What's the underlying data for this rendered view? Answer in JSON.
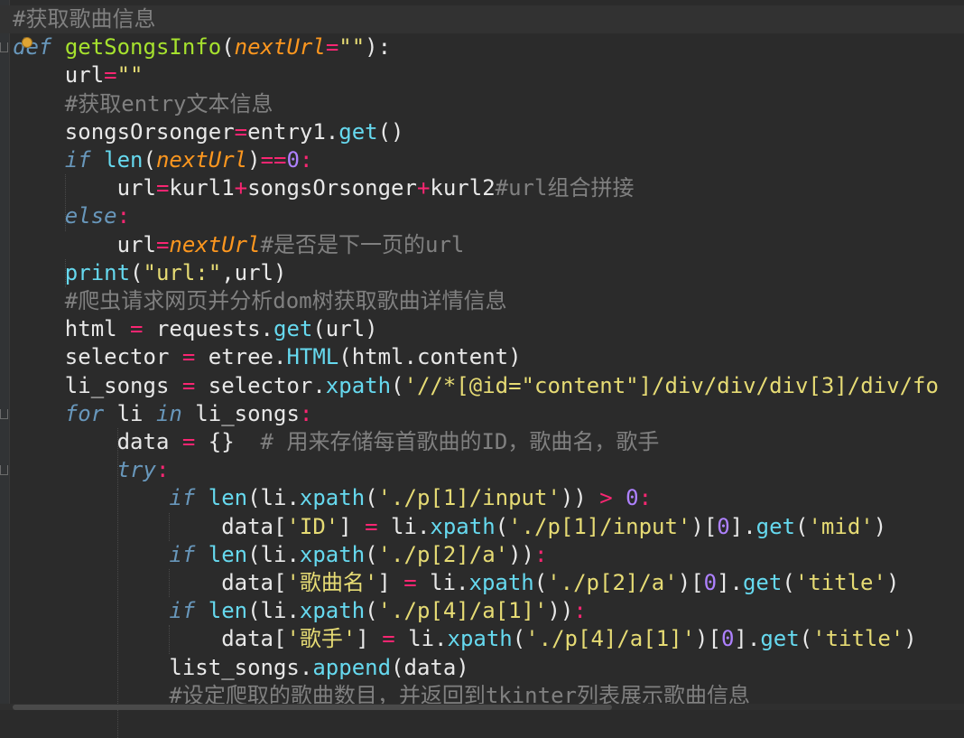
{
  "editor": {
    "lines": [
      {
        "tokens": [
          {
            "t": "#获取歌曲信息",
            "c": "cm"
          }
        ]
      },
      {
        "tokens": [
          {
            "t": "def",
            "c": "kw"
          },
          {
            "t": " ",
            "c": "pl"
          },
          {
            "t": "getSongsInfo",
            "c": "fn"
          },
          {
            "t": "(",
            "c": "pl"
          },
          {
            "t": "nextUrl",
            "c": "prm"
          },
          {
            "t": "=",
            "c": "op"
          },
          {
            "t": "\"\"",
            "c": "st"
          },
          {
            "t": "):",
            "c": "pl"
          }
        ]
      },
      {
        "tokens": [
          {
            "t": "    url",
            "c": "pl"
          },
          {
            "t": "=",
            "c": "op"
          },
          {
            "t": "\"\"",
            "c": "st"
          }
        ]
      },
      {
        "tokens": [
          {
            "t": "    #获取entry文本信息",
            "c": "cm"
          }
        ]
      },
      {
        "tokens": [
          {
            "t": "    songsOrsonger",
            "c": "pl"
          },
          {
            "t": "=",
            "c": "op"
          },
          {
            "t": "entry1.",
            "c": "pl"
          },
          {
            "t": "get",
            "c": "bi"
          },
          {
            "t": "()",
            "c": "pl"
          }
        ]
      },
      {
        "tokens": [
          {
            "t": "    ",
            "c": "pl"
          },
          {
            "t": "if",
            "c": "kw"
          },
          {
            "t": " ",
            "c": "pl"
          },
          {
            "t": "len",
            "c": "bi"
          },
          {
            "t": "(",
            "c": "pl"
          },
          {
            "t": "nextUrl",
            "c": "prm"
          },
          {
            "t": ")",
            "c": "pl"
          },
          {
            "t": "==",
            "c": "op"
          },
          {
            "t": "0",
            "c": "nm"
          },
          {
            "t": ":",
            "c": "op"
          }
        ]
      },
      {
        "tokens": [
          {
            "t": "        url",
            "c": "pl"
          },
          {
            "t": "=",
            "c": "op"
          },
          {
            "t": "kurl1",
            "c": "pl"
          },
          {
            "t": "+",
            "c": "op"
          },
          {
            "t": "songsOrsonger",
            "c": "pl"
          },
          {
            "t": "+",
            "c": "op"
          },
          {
            "t": "kurl2",
            "c": "pl"
          },
          {
            "t": "#url组合拼接",
            "c": "cm"
          }
        ]
      },
      {
        "tokens": [
          {
            "t": "    ",
            "c": "pl"
          },
          {
            "t": "else",
            "c": "kw"
          },
          {
            "t": ":",
            "c": "op"
          }
        ]
      },
      {
        "tokens": [
          {
            "t": "        url",
            "c": "pl"
          },
          {
            "t": "=",
            "c": "op"
          },
          {
            "t": "nextUrl",
            "c": "prm"
          },
          {
            "t": "#是否是下一页的url",
            "c": "cm"
          }
        ]
      },
      {
        "tokens": [
          {
            "t": "    ",
            "c": "pl"
          },
          {
            "t": "print",
            "c": "bi"
          },
          {
            "t": "(",
            "c": "pl"
          },
          {
            "t": "\"url:\"",
            "c": "st"
          },
          {
            "t": ",url)",
            "c": "pl"
          }
        ]
      },
      {
        "tokens": [
          {
            "t": "    #爬虫请求网页并分析dom树获取歌曲详情信息",
            "c": "cm"
          }
        ]
      },
      {
        "tokens": [
          {
            "t": "    html ",
            "c": "pl"
          },
          {
            "t": "=",
            "c": "op"
          },
          {
            "t": " requests.",
            "c": "pl"
          },
          {
            "t": "get",
            "c": "bi"
          },
          {
            "t": "(url)",
            "c": "pl"
          }
        ]
      },
      {
        "tokens": [
          {
            "t": "    selector ",
            "c": "pl"
          },
          {
            "t": "=",
            "c": "op"
          },
          {
            "t": " etree.",
            "c": "pl"
          },
          {
            "t": "HTML",
            "c": "bi"
          },
          {
            "t": "(html.content)",
            "c": "pl"
          }
        ]
      },
      {
        "tokens": [
          {
            "t": "    li_songs ",
            "c": "pl"
          },
          {
            "t": "=",
            "c": "op"
          },
          {
            "t": " selector.",
            "c": "pl"
          },
          {
            "t": "xpath",
            "c": "bi"
          },
          {
            "t": "(",
            "c": "pl"
          },
          {
            "t": "'//*[@id=\"content\"]/div/div/div[3]/div/fo",
            "c": "st"
          }
        ]
      },
      {
        "tokens": [
          {
            "t": "    ",
            "c": "pl"
          },
          {
            "t": "for",
            "c": "kw"
          },
          {
            "t": " li ",
            "c": "pl"
          },
          {
            "t": "in",
            "c": "kw"
          },
          {
            "t": " li_songs",
            "c": "pl"
          },
          {
            "t": ":",
            "c": "op"
          }
        ]
      },
      {
        "tokens": [
          {
            "t": "        data ",
            "c": "pl"
          },
          {
            "t": "=",
            "c": "op"
          },
          {
            "t": " {}  ",
            "c": "pl"
          },
          {
            "t": "# 用来存储每首歌曲的ID，歌曲名，歌手",
            "c": "cm"
          }
        ]
      },
      {
        "tokens": [
          {
            "t": "        ",
            "c": "pl"
          },
          {
            "t": "try",
            "c": "kw"
          },
          {
            "t": ":",
            "c": "op"
          }
        ]
      },
      {
        "tokens": [
          {
            "t": "            ",
            "c": "pl"
          },
          {
            "t": "if",
            "c": "kw"
          },
          {
            "t": " ",
            "c": "pl"
          },
          {
            "t": "len",
            "c": "bi"
          },
          {
            "t": "(li.",
            "c": "pl"
          },
          {
            "t": "xpath",
            "c": "bi"
          },
          {
            "t": "(",
            "c": "pl"
          },
          {
            "t": "'./p[1]/input'",
            "c": "st"
          },
          {
            "t": ")) ",
            "c": "pl"
          },
          {
            "t": ">",
            "c": "op"
          },
          {
            "t": " ",
            "c": "pl"
          },
          {
            "t": "0",
            "c": "nm"
          },
          {
            "t": ":",
            "c": "op"
          }
        ]
      },
      {
        "tokens": [
          {
            "t": "                data[",
            "c": "pl"
          },
          {
            "t": "'ID'",
            "c": "st"
          },
          {
            "t": "] ",
            "c": "pl"
          },
          {
            "t": "=",
            "c": "op"
          },
          {
            "t": " li.",
            "c": "pl"
          },
          {
            "t": "xpath",
            "c": "bi"
          },
          {
            "t": "(",
            "c": "pl"
          },
          {
            "t": "'./p[1]/input'",
            "c": "st"
          },
          {
            "t": ")[",
            "c": "pl"
          },
          {
            "t": "0",
            "c": "nm"
          },
          {
            "t": "].",
            "c": "pl"
          },
          {
            "t": "get",
            "c": "bi"
          },
          {
            "t": "(",
            "c": "pl"
          },
          {
            "t": "'mid'",
            "c": "st"
          },
          {
            "t": ")",
            "c": "pl"
          }
        ]
      },
      {
        "tokens": [
          {
            "t": "            ",
            "c": "pl"
          },
          {
            "t": "if",
            "c": "kw"
          },
          {
            "t": " ",
            "c": "pl"
          },
          {
            "t": "len",
            "c": "bi"
          },
          {
            "t": "(li.",
            "c": "pl"
          },
          {
            "t": "xpath",
            "c": "bi"
          },
          {
            "t": "(",
            "c": "pl"
          },
          {
            "t": "'./p[2]/a'",
            "c": "st"
          },
          {
            "t": "))",
            "c": "pl"
          },
          {
            "t": ":",
            "c": "op"
          }
        ]
      },
      {
        "tokens": [
          {
            "t": "                data[",
            "c": "pl"
          },
          {
            "t": "'歌曲名'",
            "c": "st"
          },
          {
            "t": "] ",
            "c": "pl"
          },
          {
            "t": "=",
            "c": "op"
          },
          {
            "t": " li.",
            "c": "pl"
          },
          {
            "t": "xpath",
            "c": "bi"
          },
          {
            "t": "(",
            "c": "pl"
          },
          {
            "t": "'./p[2]/a'",
            "c": "st"
          },
          {
            "t": ")[",
            "c": "pl"
          },
          {
            "t": "0",
            "c": "nm"
          },
          {
            "t": "].",
            "c": "pl"
          },
          {
            "t": "get",
            "c": "bi"
          },
          {
            "t": "(",
            "c": "pl"
          },
          {
            "t": "'title'",
            "c": "st"
          },
          {
            "t": ")",
            "c": "pl"
          }
        ]
      },
      {
        "tokens": [
          {
            "t": "            ",
            "c": "pl"
          },
          {
            "t": "if",
            "c": "kw"
          },
          {
            "t": " ",
            "c": "pl"
          },
          {
            "t": "len",
            "c": "bi"
          },
          {
            "t": "(li.",
            "c": "pl"
          },
          {
            "t": "xpath",
            "c": "bi"
          },
          {
            "t": "(",
            "c": "pl"
          },
          {
            "t": "'./p[4]/a[1]'",
            "c": "st"
          },
          {
            "t": "))",
            "c": "pl"
          },
          {
            "t": ":",
            "c": "op"
          }
        ]
      },
      {
        "tokens": [
          {
            "t": "                data[",
            "c": "pl"
          },
          {
            "t": "'歌手'",
            "c": "st"
          },
          {
            "t": "] ",
            "c": "pl"
          },
          {
            "t": "=",
            "c": "op"
          },
          {
            "t": " li.",
            "c": "pl"
          },
          {
            "t": "xpath",
            "c": "bi"
          },
          {
            "t": "(",
            "c": "pl"
          },
          {
            "t": "'./p[4]/a[1]'",
            "c": "st"
          },
          {
            "t": ")[",
            "c": "pl"
          },
          {
            "t": "0",
            "c": "nm"
          },
          {
            "t": "].",
            "c": "pl"
          },
          {
            "t": "get",
            "c": "bi"
          },
          {
            "t": "(",
            "c": "pl"
          },
          {
            "t": "'title'",
            "c": "st"
          },
          {
            "t": ")",
            "c": "pl"
          }
        ]
      },
      {
        "tokens": [
          {
            "t": "            list_songs.",
            "c": "pl"
          },
          {
            "t": "append",
            "c": "bi"
          },
          {
            "t": "(data)",
            "c": "pl"
          }
        ]
      },
      {
        "tokens": [
          {
            "t": "            #设定爬取的歌曲数目，并返回到tkinter列表展示歌曲信息",
            "c": "cm"
          }
        ]
      }
    ],
    "icons": {
      "intention_bulb": "lightbulb-icon",
      "fold_marker": "fold-marker-icon"
    },
    "colors": {
      "background": "#2b2b2b",
      "comment": "#808080",
      "keyword": "#6897bb",
      "function": "#a6e22e",
      "builtin": "#66d9ef",
      "param": "#fd971f",
      "string": "#e6db74",
      "operator": "#f92672",
      "number": "#ae81ff",
      "text": "#e8e8e8"
    }
  }
}
